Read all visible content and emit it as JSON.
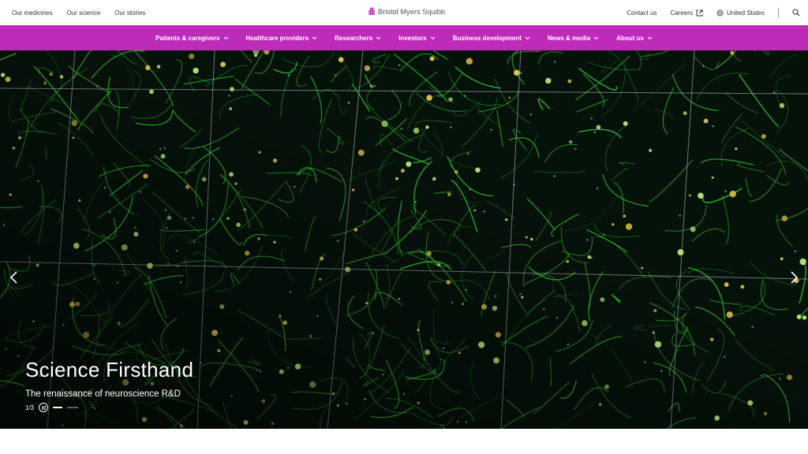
{
  "topbar": {
    "left_links": [
      "Our medicines",
      "Our science",
      "Our stories"
    ],
    "logo_text": "Bristol Myers Squibb",
    "contact": "Contact us",
    "careers": "Careers",
    "region": "United States"
  },
  "nav": {
    "items": [
      "Patients & caregivers",
      "Healthcare providers",
      "Researchers",
      "Investors",
      "Business development",
      "News & media",
      "About us"
    ]
  },
  "hero": {
    "title": "Science Firsthand",
    "subtitle": "The renaissance of neuroscience R&D",
    "counter": "1/3"
  },
  "colors": {
    "brand": "#be2bbb",
    "hero_bg": "#05120a",
    "neuron_green": "#2fd12a",
    "neuron_yellow": "#e6c54a"
  },
  "icons": {
    "logo": "hand-logo-icon",
    "external": "external-link-icon",
    "globe": "globe-icon",
    "search": "search-icon",
    "chevron": "chevron-down-icon",
    "prev": "chevron-left-icon",
    "next": "chevron-right-icon",
    "pause": "pause-icon"
  }
}
